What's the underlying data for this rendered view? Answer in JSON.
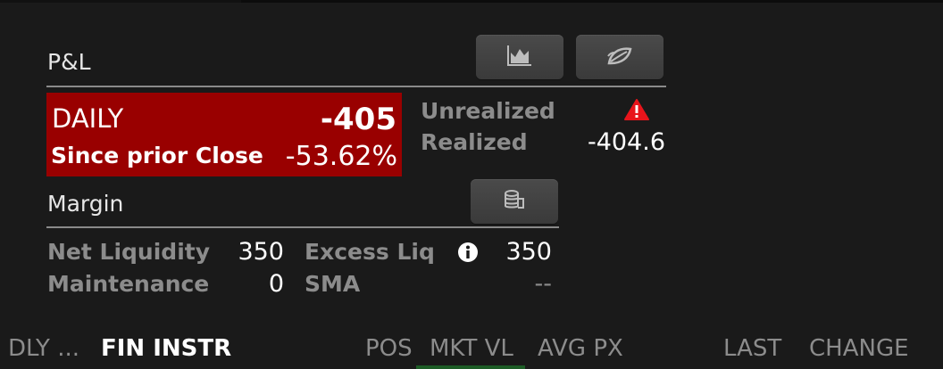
{
  "pnl": {
    "title": "P&L",
    "chart_icon": "chart-icon",
    "leaf_icon": "leaf-icon",
    "daily_label": "DAILY",
    "daily_value": "-405",
    "since_label": "Since prior Close",
    "since_value": "-53.62%",
    "unrealized_label": "Unrealized",
    "realized_label": "Realized",
    "realized_value": "-404.6",
    "warning_icon": "warning-icon",
    "accent_color": "#990000"
  },
  "margin": {
    "title": "Margin",
    "coins_icon": "coins-icon",
    "net_liquidity_label": "Net Liquidity",
    "net_liquidity_value": "350",
    "excess_liq_label": "Excess Liq",
    "excess_liq_value": "350",
    "info_icon": "info-icon",
    "maintenance_label": "Maintenance",
    "maintenance_value": "0",
    "sma_label": "SMA",
    "sma_value": "--"
  },
  "columns": {
    "dly": "DLY ...",
    "fin_instr": "FIN INSTR",
    "pos": "POS",
    "mkt_vl": "MKT VL",
    "avg_px": "AVG PX",
    "last": "LAST",
    "change": "CHANGE"
  }
}
